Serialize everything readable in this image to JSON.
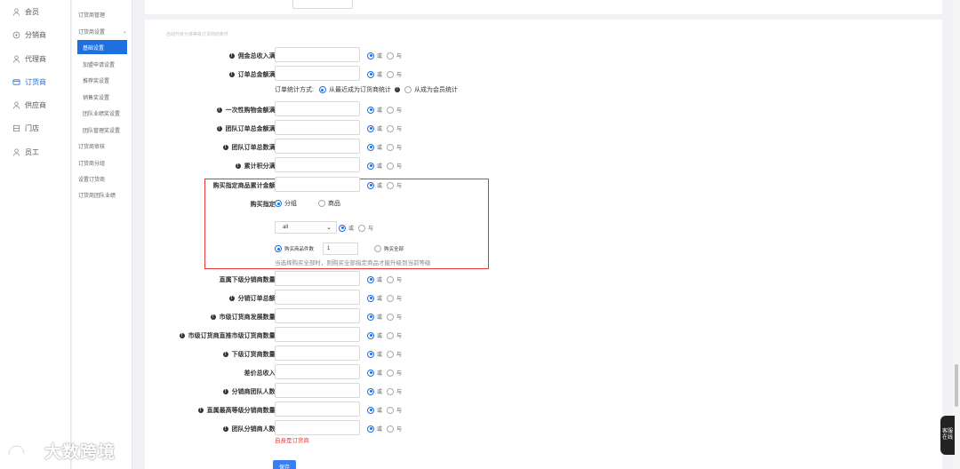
{
  "left_nav": {
    "items": [
      {
        "label": "会员",
        "icon": "user-icon"
      },
      {
        "label": "分销商",
        "icon": "distributor-icon"
      },
      {
        "label": "代理商",
        "icon": "agent-icon"
      },
      {
        "label": "订货商",
        "icon": "orderer-icon",
        "active": true
      },
      {
        "label": "供应商",
        "icon": "supplier-icon"
      },
      {
        "label": "门店",
        "icon": "store-icon"
      },
      {
        "label": "员工",
        "icon": "staff-icon"
      }
    ]
  },
  "sub_nav": {
    "items": [
      {
        "label": "订货商管理"
      },
      {
        "label": "订货商设置",
        "expanded": true
      },
      {
        "label": "基础设置",
        "active": true
      },
      {
        "label": "加盟申请设置"
      },
      {
        "label": "推荐奖设置"
      },
      {
        "label": "销售奖设置"
      },
      {
        "label": "团队业绩奖设置"
      },
      {
        "label": "团队管理奖设置"
      },
      {
        "label": "订货商审核"
      },
      {
        "label": "订货商分组"
      },
      {
        "label": "设置订货商"
      },
      {
        "label": "订货商团队业绩"
      }
    ]
  },
  "form": {
    "section_title": "自动升级为该等级订货商的条件",
    "or_label": "或",
    "and_label": "与",
    "fields_top": [
      {
        "label": "佣金总收入满:",
        "info": true
      },
      {
        "label": "订单总金额满:",
        "info": true
      }
    ],
    "stat_method": {
      "label": "订单统计方式:",
      "option1": "从最近成为订货商统计",
      "option2": "从成为会员统计"
    },
    "fields_mid": [
      {
        "label": "一次性购物金额满:",
        "info": true
      },
      {
        "label": "团队订单总金额满:",
        "info": true
      },
      {
        "label": "团队订单总数满:",
        "info": true
      },
      {
        "label": "累计积分满:",
        "info": true
      }
    ],
    "highlight": {
      "amount_label": "购买指定商品累计金额:",
      "purchase_label": "购买指定:",
      "opt_group": "分组",
      "opt_goods": "商品",
      "select_value": "all",
      "count_label": "购买商品件数",
      "count_value": "1",
      "buy_all_label": "购买全部",
      "hint": "当选择购买全部时，则购买全部指定商品才能升级到当前等级"
    },
    "fields_bottom": [
      {
        "label": "直属下级分销商数量:",
        "info": false
      },
      {
        "label": "分销订单总额:",
        "info": true
      },
      {
        "label": "市级订货商发展数量:",
        "info": true
      },
      {
        "label": "市级订货商直推市级订货商数量:",
        "info": true
      },
      {
        "label": "下级订货商数量:",
        "info": true
      },
      {
        "label": "差价总收入:",
        "info": false
      },
      {
        "label": "分销商团队人数:",
        "info": true
      },
      {
        "label": "直属最高等级分销商数量:",
        "info": true
      },
      {
        "label": "团队分销商人数:",
        "info": true
      }
    ],
    "bottom_error": "自身是订货商",
    "save_label": "保存"
  },
  "service_tab": "客服在线",
  "watermark": "大数跨境"
}
